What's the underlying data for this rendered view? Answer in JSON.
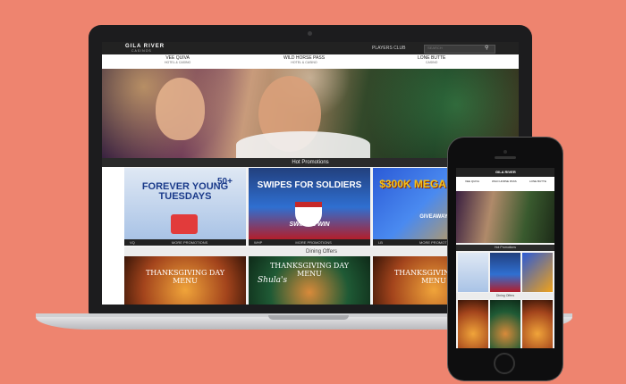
{
  "site": {
    "logo": "GILA RIVER",
    "logo_sub": "CASINOS",
    "players_club": "PLAYERS CLUB",
    "search_placeholder": "SEARCH"
  },
  "nav": [
    {
      "name": "VEE QUIVA",
      "sub": "HOTEL & CASINO"
    },
    {
      "name": "WILD HORSE PASS",
      "sub": "HOTEL & CASINO"
    },
    {
      "name": "LONE BUTTE",
      "sub": "CASINO"
    }
  ],
  "sections": {
    "hot_promotions": "Hot Promotions",
    "dining_offers": "Dining Offers"
  },
  "promotions": [
    {
      "headline": "FOREVER YOUNG TUESDAYS",
      "badge": "50+",
      "venue": "VQ",
      "caption": "MORE PROMOTIONS"
    },
    {
      "headline": "SWIPES FOR SOLDIERS",
      "badge": "SWIPE & WIN",
      "venue": "WHP",
      "caption": "MORE PROMOTIONS"
    },
    {
      "headline": "$300K MEGA MONEY",
      "badge": "GIVEAWAY",
      "venue": "LB",
      "caption": "MORE PROMOTIONS"
    }
  ],
  "dining": [
    {
      "title": "THANKSGIVING DAY MENU"
    },
    {
      "title": "THANKSGIVING DAY MENU",
      "brand": "Shula's"
    },
    {
      "title": "THANKSGIVING DAY MENU"
    }
  ],
  "colors": {
    "background": "#ee846f",
    "site_dark": "#222222",
    "promo_blue": "#2f6fd1",
    "promo_gold": "#f3c21a"
  }
}
